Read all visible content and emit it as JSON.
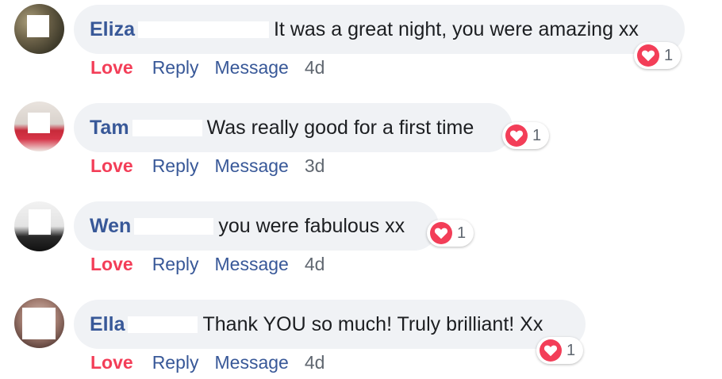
{
  "comments": [
    {
      "author": "Eliza",
      "text": "It was a great night, you were amazing xx",
      "reaction_count": "1",
      "actions": {
        "love": "Love",
        "reply": "Reply",
        "message": "Message",
        "time": "4d"
      }
    },
    {
      "author": "Tam",
      "text": "Was really good for a first time",
      "reaction_count": "1",
      "actions": {
        "love": "Love",
        "reply": "Reply",
        "message": "Message",
        "time": "3d"
      }
    },
    {
      "author": "Wen",
      "text": "you were fabulous xx",
      "reaction_count": "1",
      "actions": {
        "love": "Love",
        "reply": "Reply",
        "message": "Message",
        "time": "4d"
      }
    },
    {
      "author": "Ella",
      "text": "Thank YOU so much! Truly brilliant! Xx",
      "reaction_count": "1",
      "actions": {
        "love": "Love",
        "reply": "Reply",
        "message": "Message",
        "time": "4d"
      }
    }
  ],
  "colors": {
    "author_link": "#385898",
    "love_accent": "#f33e58",
    "bubble_bg": "#f0f2f5",
    "meta_gray": "#606770"
  },
  "icons": {
    "reaction": "heart-icon"
  }
}
